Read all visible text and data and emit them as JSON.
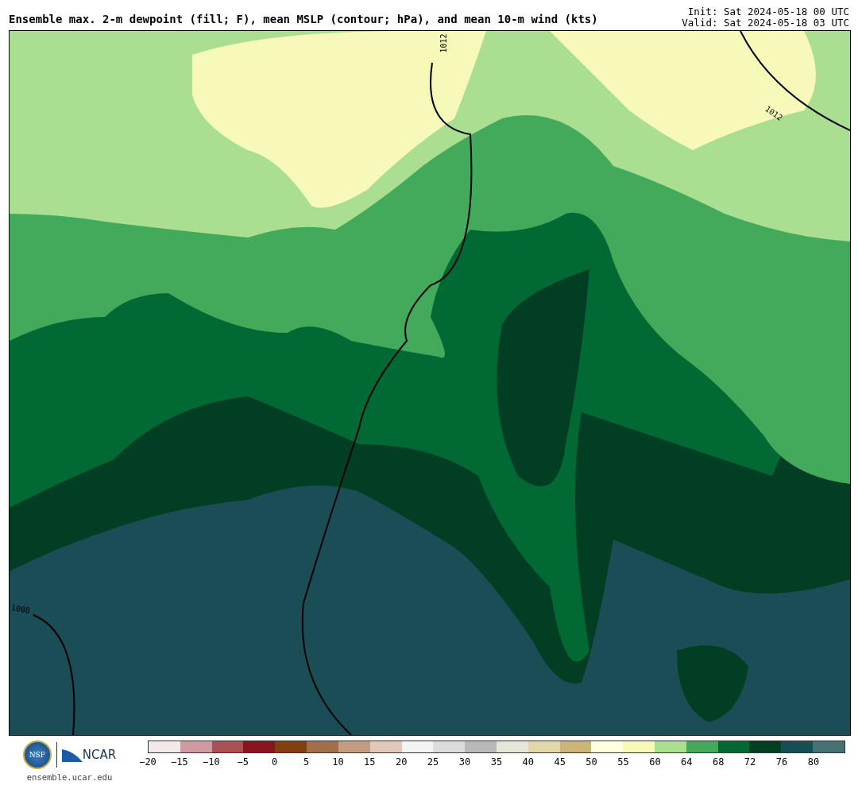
{
  "title": "Ensemble max. 2-m dewpoint (fill; F), mean MSLP (contour; hPa), and mean 10-m wind (kts)",
  "init": "Init: Sat 2024-05-18 00 UTC",
  "valid": "Valid: Sat 2024-05-18 03 UTC",
  "map": {
    "contour_labels": [
      "1012",
      "1012",
      "1008"
    ]
  },
  "logos": {
    "nsf": "NSF",
    "ncar": "NCAR",
    "site": "ensemble.ucar.edu"
  },
  "colorbar": {
    "swatches": [
      {
        "color": "#f4e9e9"
      },
      {
        "color": "#d09ba0"
      },
      {
        "color": "#a85256"
      },
      {
        "color": "#881420"
      },
      {
        "color": "#82400f"
      },
      {
        "color": "#a36e4c"
      },
      {
        "color": "#c29c83"
      },
      {
        "color": "#e0c9bb"
      },
      {
        "color": "#f3f3f3"
      },
      {
        "color": "#dcdcdc"
      },
      {
        "color": "#b9b9b9"
      },
      {
        "color": "#e6e6d8"
      },
      {
        "color": "#e4d5ab"
      },
      {
        "color": "#cbb677"
      },
      {
        "color": "#fefee0"
      },
      {
        "color": "#f7f9b9"
      },
      {
        "color": "#aade90"
      },
      {
        "color": "#43aa5c"
      },
      {
        "color": "#006934"
      },
      {
        "color": "#023e24"
      },
      {
        "color": "#184d55"
      },
      {
        "color": "#477073"
      }
    ],
    "ticks": [
      "−20",
      "−15",
      "−10",
      "−5",
      "0",
      "5",
      "10",
      "15",
      "20",
      "25",
      "30",
      "35",
      "40",
      "45",
      "50",
      "55",
      "60",
      "64",
      "68",
      "72",
      "76",
      "80"
    ]
  }
}
